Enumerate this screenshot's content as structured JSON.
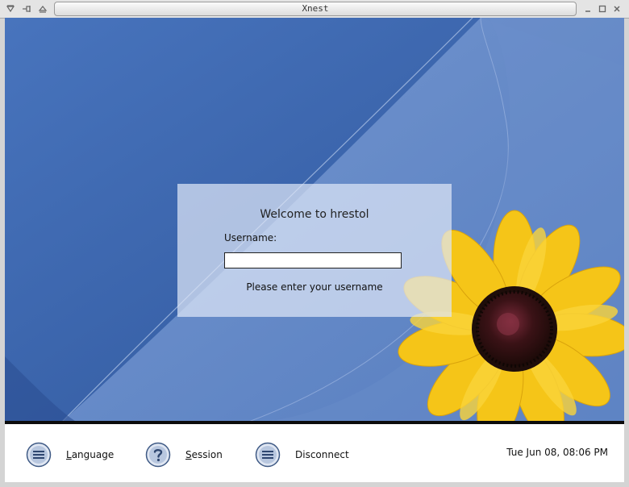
{
  "window": {
    "title": "Xnest"
  },
  "login": {
    "welcome": "Welcome to hrestol",
    "username_label": "Username:",
    "username_value": "",
    "hint": "Please enter your username"
  },
  "bottom_bar": {
    "language": {
      "mnemonic": "L",
      "rest": "anguage",
      "icon": "list-icon"
    },
    "session": {
      "mnemonic": "S",
      "rest": "ession",
      "icon": "question-icon"
    },
    "disconnect": {
      "mnemonic": "",
      "rest": "Disconnect",
      "icon": "list-icon"
    },
    "clock": "Tue Jun 08, 08:06 PM"
  },
  "colors": {
    "background_blue": "#3c66ad",
    "panel": "#dee6f6",
    "flower_petal": "#f5c518",
    "flower_center": "#3a1a14"
  }
}
